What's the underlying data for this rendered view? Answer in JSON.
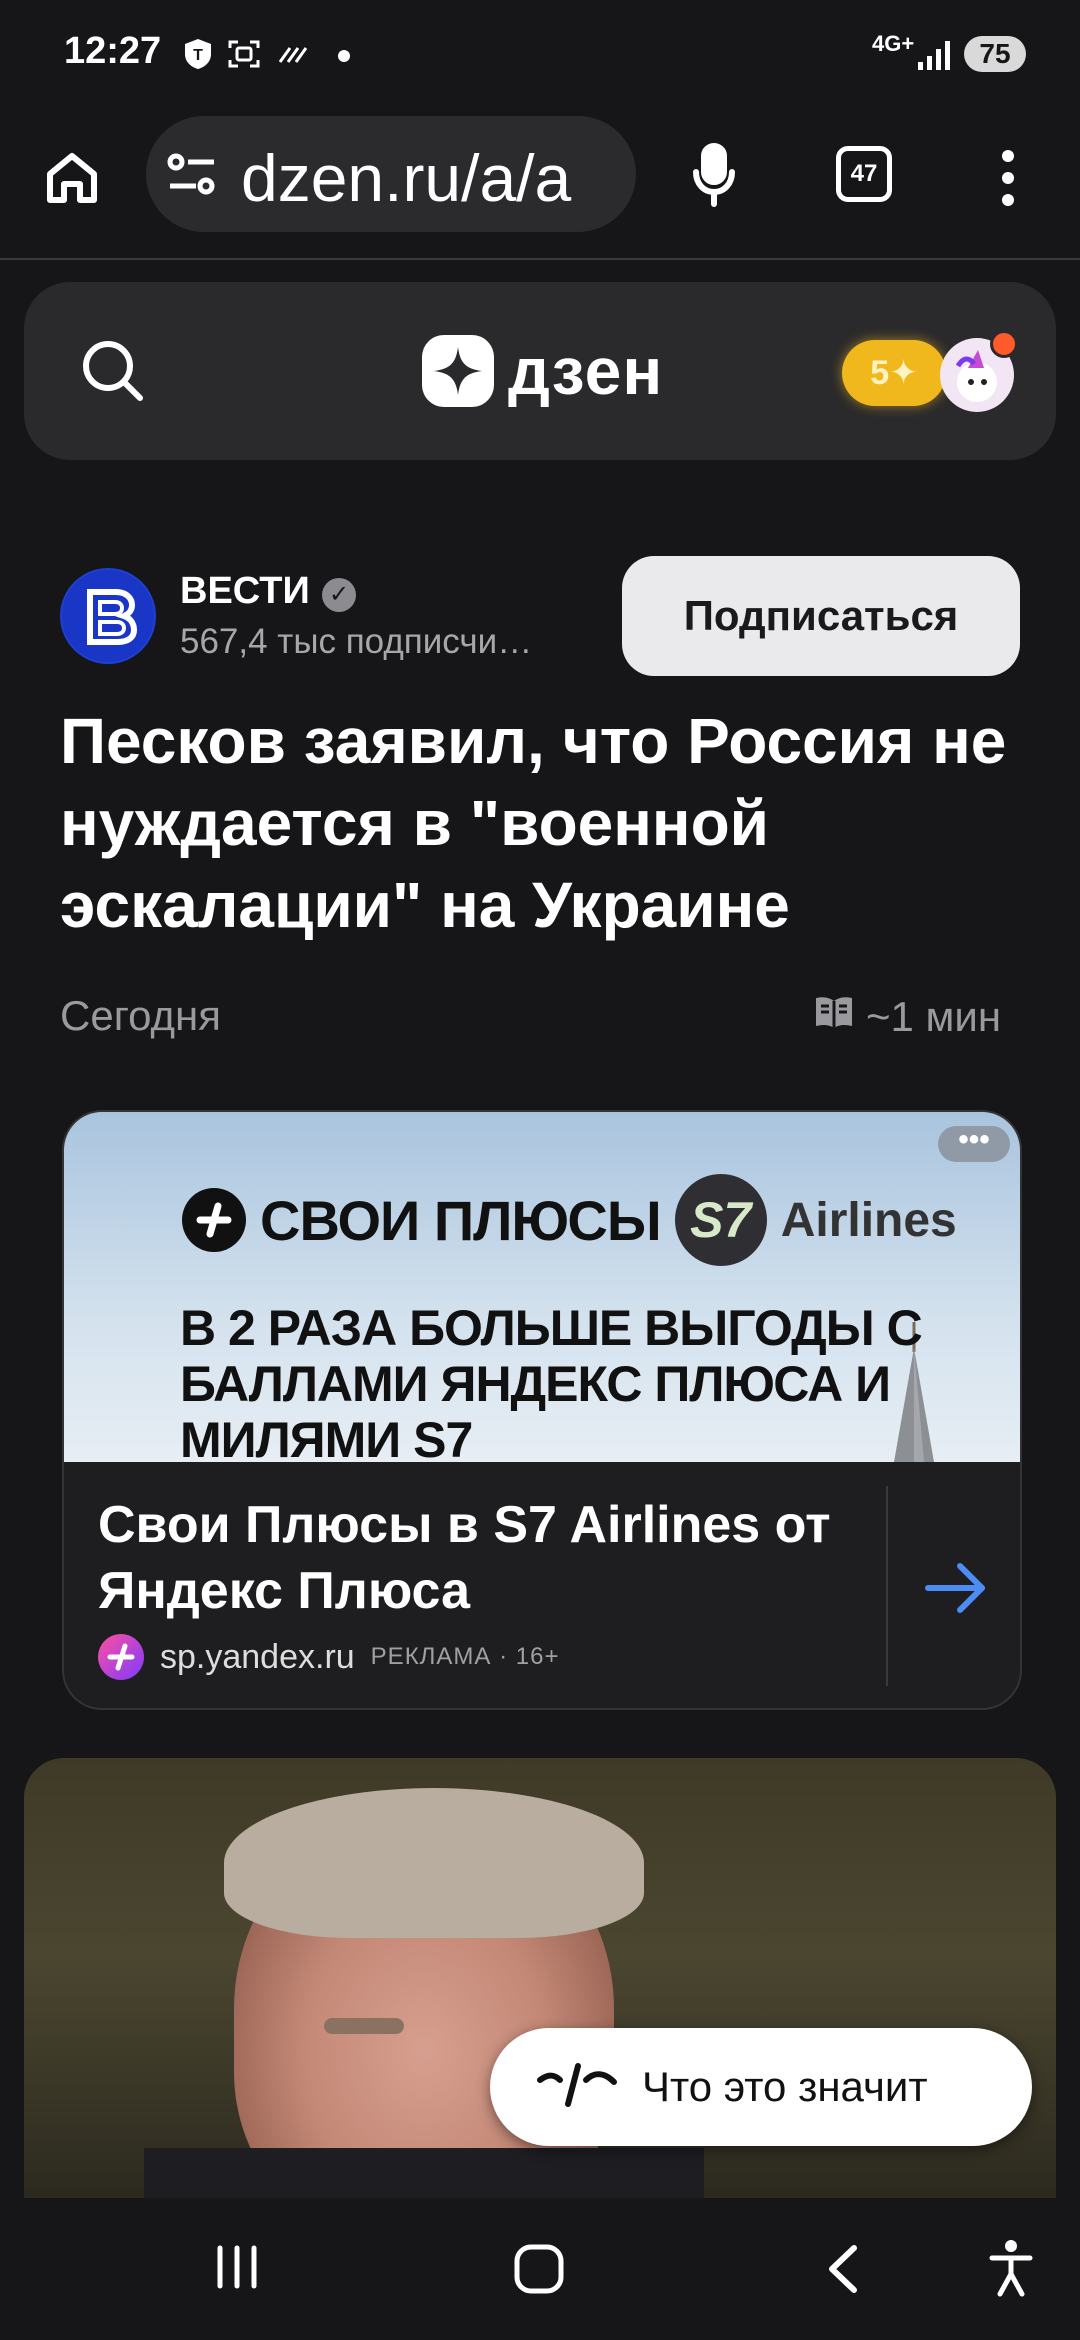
{
  "status_bar": {
    "time": "12:27",
    "network": "4G+",
    "battery": "75"
  },
  "browser": {
    "url": "dzen.ru/a/a",
    "tab_count": "47"
  },
  "dzen": {
    "logo_text": "дзен",
    "coins": "5✦"
  },
  "article": {
    "channel_name": "ВЕСТИ",
    "channel_subscribers": "567,4 тыс подписчи…",
    "subscribe_label": "Подписаться",
    "title": "Песков заявил, что Россия не нуждается в \"военной эскалации\" на Украине",
    "date": "Сегодня",
    "read_time": "~1 мин"
  },
  "ad": {
    "brand_line": "СВОИ ПЛЮСЫ",
    "airline_mark": "S7",
    "airline_word": "Airlines",
    "promo_text": "В 2 РАЗА БОЛЬШЕ ВЫГОДЫ С БАЛЛАМИ ЯНДЕКС ПЛЮСА И МИЛЯМИ S7",
    "title": "Свои Плюсы в S7 Airlines от Яндекс Плюса",
    "source": "sp.yandex.ru",
    "label": "РЕКЛАМА · 16+"
  },
  "chip": {
    "text": "Что это значит"
  }
}
